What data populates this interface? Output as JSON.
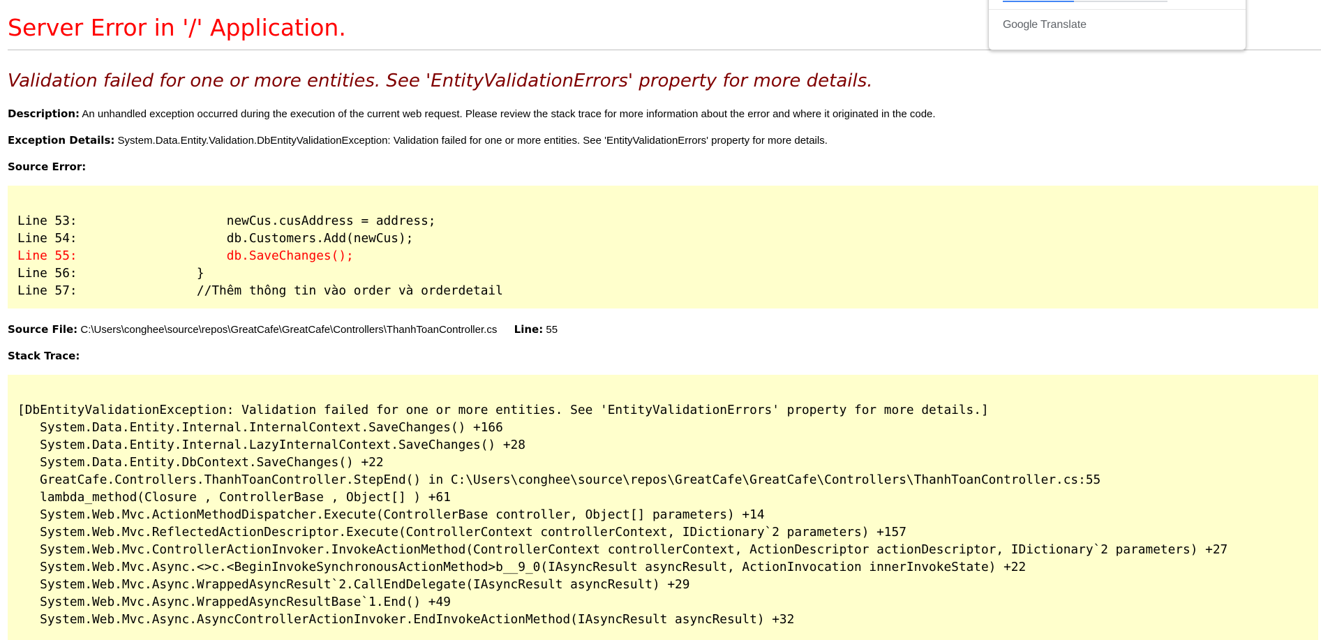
{
  "page": {
    "title": "Server Error in '/' Application.",
    "message": "Validation failed for one or more entities. See 'EntityValidationErrors' property for more details."
  },
  "description": {
    "label": "Description:",
    "text": "An unhandled exception occurred during the execution of the current web request. Please review the stack trace for more information about the error and where it originated in the code."
  },
  "exception_details": {
    "label": "Exception Details:",
    "text": "System.Data.Entity.Validation.DbEntityValidationException: Validation failed for one or more entities. See 'EntityValidationErrors' property for more details."
  },
  "source_error": {
    "label": "Source Error:",
    "lines": [
      {
        "text": "Line 53:                    newCus.cusAddress = address;",
        "error": false
      },
      {
        "text": "Line 54:                    db.Customers.Add(newCus);",
        "error": false
      },
      {
        "text": "Line 55:                    db.SaveChanges();",
        "error": true
      },
      {
        "text": "Line 56:                }",
        "error": false
      },
      {
        "text": "Line 57:                //Thêm thông tin vào order và orderdetail",
        "error": false
      }
    ]
  },
  "source_file": {
    "label": "Source File:",
    "path": "C:\\Users\\conghee\\source\\repos\\GreatCafe\\GreatCafe\\Controllers\\ThanhToanController.cs",
    "line_label": "Line:",
    "line_value": "55"
  },
  "stack_trace": {
    "label": "Stack Trace:",
    "lines": [
      "[DbEntityValidationException: Validation failed for one or more entities. See 'EntityValidationErrors' property for more details.]",
      "   System.Data.Entity.Internal.InternalContext.SaveChanges() +166",
      "   System.Data.Entity.Internal.LazyInternalContext.SaveChanges() +28",
      "   System.Data.Entity.DbContext.SaveChanges() +22",
      "   GreatCafe.Controllers.ThanhToanController.StepEnd() in C:\\Users\\conghee\\source\\repos\\GreatCafe\\GreatCafe\\Controllers\\ThanhToanController.cs:55",
      "   lambda_method(Closure , ControllerBase , Object[] ) +61",
      "   System.Web.Mvc.ActionMethodDispatcher.Execute(ControllerBase controller, Object[] parameters) +14",
      "   System.Web.Mvc.ReflectedActionDescriptor.Execute(ControllerContext controllerContext, IDictionary`2 parameters) +157",
      "   System.Web.Mvc.ControllerActionInvoker.InvokeActionMethod(ControllerContext controllerContext, ActionDescriptor actionDescriptor, IDictionary`2 parameters) +27",
      "   System.Web.Mvc.Async.<>c.<BeginInvokeSynchronousActionMethod>b__9_0(IAsyncResult asyncResult, ActionInvocation innerInvokeState) +22",
      "   System.Web.Mvc.Async.WrappedAsyncResult`2.CallEndDelegate(IAsyncResult asyncResult) +29",
      "   System.Web.Mvc.Async.WrappedAsyncResultBase`1.End() +49",
      "   System.Web.Mvc.Async.AsyncControllerActionInvoker.EndInvokeActionMethod(IAsyncResult asyncResult) +32"
    ]
  },
  "google_translate": {
    "brand": "Google",
    "product": "Translate"
  }
}
